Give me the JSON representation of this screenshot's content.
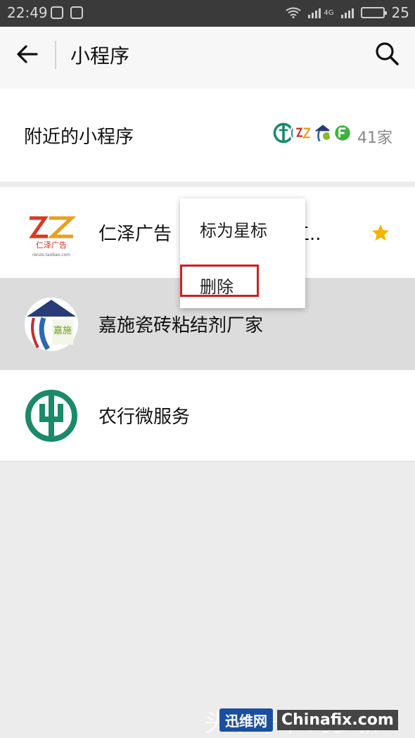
{
  "status_bar": {
    "time": "22:49",
    "battery": "25",
    "network": "4G"
  },
  "header": {
    "title": "小程序"
  },
  "nearby": {
    "label": "附近的小程序",
    "count": "41家"
  },
  "list": [
    {
      "name": "仁泽广告",
      "name_tail": "作加工..",
      "starred": true
    },
    {
      "name": "嘉施瓷砖粘结剂厂家"
    },
    {
      "name": "农行微服务"
    }
  ],
  "context_menu": {
    "items": [
      "标为星标",
      "删除"
    ]
  },
  "logo_text": {
    "rz_brand": "仁泽广告",
    "rz_url": "renze.taobao.com",
    "jiashi": "嘉施"
  },
  "watermark": {
    "text": "头条号 / 淘多拆",
    "brand": "迅维网",
    "site": "Chinafix.com"
  },
  "colors": {
    "accent_star": "#f5b400",
    "highlight_box": "#d02020",
    "abc_green": "#1a8a6a"
  }
}
